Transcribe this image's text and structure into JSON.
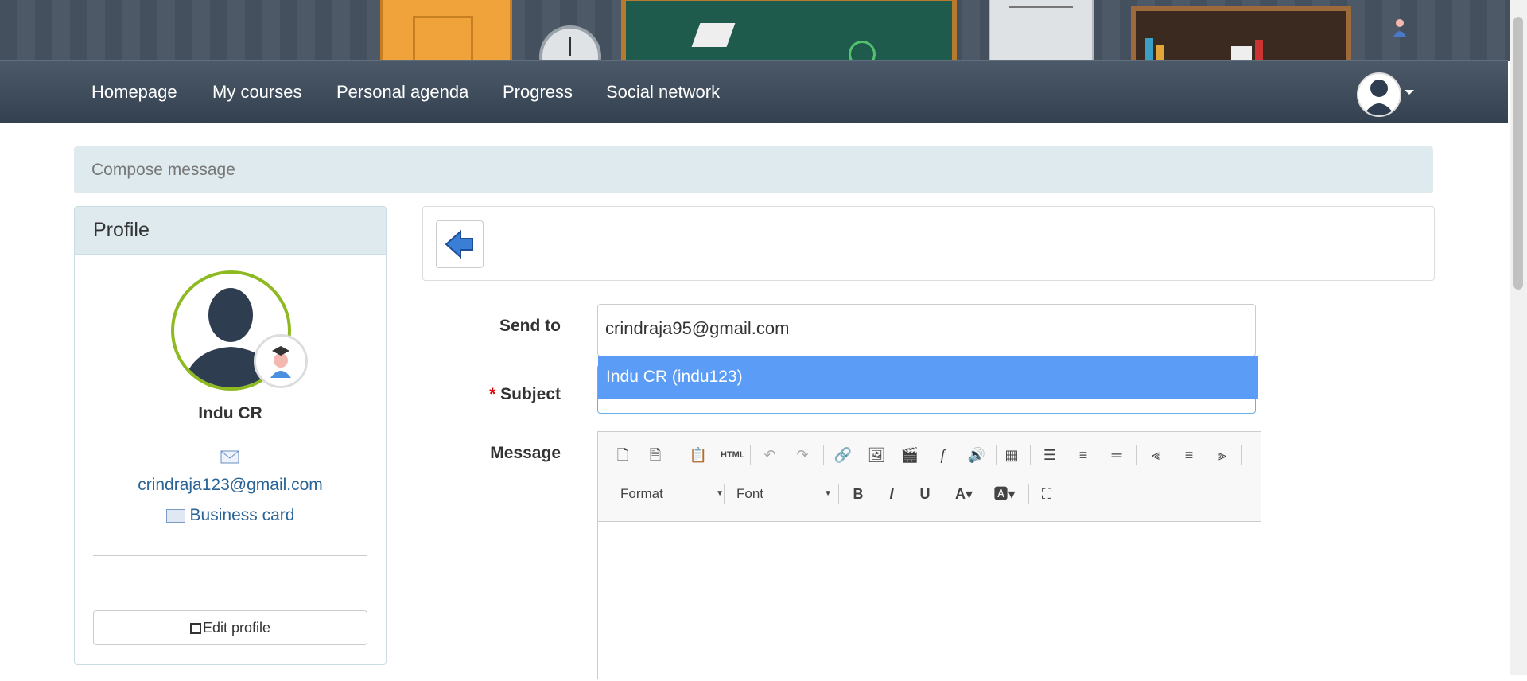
{
  "nav": {
    "items": [
      {
        "label": "Homepage"
      },
      {
        "label": "My courses"
      },
      {
        "label": "Personal agenda"
      },
      {
        "label": "Progress"
      },
      {
        "label": "Social network"
      }
    ]
  },
  "breadcrumb": {
    "text": "Compose message"
  },
  "profile": {
    "heading": "Profile",
    "name": "Indu CR",
    "email": "crindraja123@gmail.com",
    "business_card": "Business card",
    "edit_button": "Edit profile"
  },
  "form": {
    "send_to_label": "Send to",
    "send_to_value": "crindraja95@gmail.com",
    "subject_required": "*",
    "subject_label": "Subject",
    "message_label": "Message",
    "suggestion": "Indu CR (indu123)"
  },
  "editor": {
    "format_label": "Format",
    "font_label": "Font",
    "icons": [
      "new-page-icon",
      "templates-icon",
      "paste-word-icon",
      "paste-html-icon",
      "undo-icon",
      "redo-icon",
      "link-icon",
      "image-icon",
      "video-icon",
      "flash-icon",
      "audio-icon",
      "table-icon",
      "bullet-list-icon",
      "numbered-list-icon",
      "horizontal-rule-icon",
      "align-left-icon",
      "align-center-icon",
      "align-right-icon",
      "bold-icon",
      "italic-icon",
      "underline-icon",
      "text-color-icon",
      "background-color-icon",
      "maximize-icon"
    ]
  },
  "colors": {
    "navbar": "#3b4856",
    "accent": "#5b9df6",
    "link": "#2a6496",
    "breadcrumb_bg": "#deeaee",
    "profile_ring": "#8db921"
  }
}
